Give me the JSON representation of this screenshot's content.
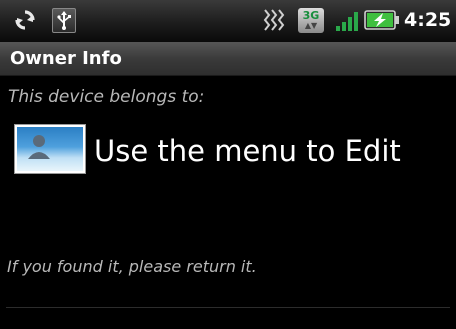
{
  "status_bar": {
    "time": "4:25",
    "network_type": "3G",
    "icons": [
      "sync-icon",
      "usb-icon",
      "vibrate-icon",
      "3g-data-icon",
      "signal-icon",
      "battery-charging-icon"
    ],
    "accent_color": "#1a8f3e"
  },
  "title_bar": {
    "title": "Owner Info"
  },
  "content": {
    "belongs_label": "This device belongs to:",
    "owner_placeholder": "Use the menu to Edit",
    "return_message": "If you found it, please return it."
  }
}
